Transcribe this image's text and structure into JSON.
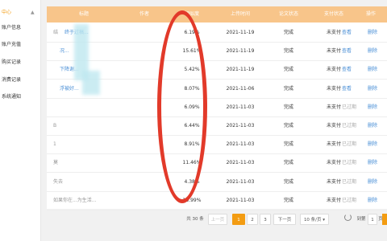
{
  "sidebar": {
    "items": [
      {
        "label": "中心",
        "active": true
      },
      {
        "label": "账户信息"
      },
      {
        "label": "账户充值"
      },
      {
        "label": "购买记录"
      },
      {
        "label": "消费记录"
      },
      {
        "label": "系统通知"
      }
    ],
    "caret": "▲"
  },
  "table": {
    "headers": [
      "标题",
      "作者",
      "相似度",
      "上传时间",
      "论文状态",
      "支付状态",
      "操作"
    ],
    "rows": [
      {
        "title_prefix": "结",
        "title_link": "终于过稿...",
        "similarity": "6.19%",
        "date": "2021-11-19",
        "paper_status": "完成",
        "pay_status": "未支付",
        "action1": "查看",
        "action2": "删除",
        "expired": false
      },
      {
        "title_prefix": "",
        "title_link": "况...",
        "similarity": "15.61%",
        "date": "2021-11-19",
        "paper_status": "完成",
        "pay_status": "未支付",
        "action1": "查看",
        "action2": "删除",
        "expired": false
      },
      {
        "title_prefix": "",
        "title_link": "下降谢...",
        "similarity": "5.42%",
        "date": "2021-11-19",
        "paper_status": "完成",
        "pay_status": "未支付",
        "action1": "查看",
        "action2": "删除",
        "expired": false
      },
      {
        "title_prefix": "",
        "title_link": "浮被好...",
        "similarity": "8.07%",
        "date": "2021-11-06",
        "paper_status": "完成",
        "pay_status": "未支付",
        "action1": "查看",
        "action2": "删除",
        "expired": false
      },
      {
        "title_prefix": "",
        "title_link": "",
        "similarity": "6.09%",
        "date": "2021-11-03",
        "paper_status": "完成",
        "pay_status": "未支付",
        "action1": "已过期",
        "action2": "删除",
        "expired": true
      },
      {
        "title_prefix": "B",
        "title_link": "",
        "similarity": "6.44%",
        "date": "2021-11-03",
        "paper_status": "完成",
        "pay_status": "未支付",
        "action1": "已过期",
        "action2": "删除",
        "expired": true
      },
      {
        "title_prefix": "1",
        "title_link": "",
        "similarity": "8.91%",
        "date": "2021-11-03",
        "paper_status": "完成",
        "pay_status": "未支付",
        "action1": "已过期",
        "action2": "删除",
        "expired": true
      },
      {
        "title_prefix": "莫",
        "title_link": "",
        "similarity": "11.46%",
        "date": "2021-11-03",
        "paper_status": "完成",
        "pay_status": "未支付",
        "action1": "已过期",
        "action2": "删除",
        "expired": true
      },
      {
        "title_prefix": "失去",
        "title_link": "",
        "similarity": "4.38%",
        "date": "2021-11-03",
        "paper_status": "完成",
        "pay_status": "未支付",
        "action1": "已过期",
        "action2": "删除",
        "expired": true
      },
      {
        "title_prefix": "如果你在...为生活...",
        "title_link": "",
        "similarity": "13.99%",
        "date": "2021-11-03",
        "paper_status": "完成",
        "pay_status": "未支付",
        "action1": "已过期",
        "action2": "删除",
        "expired": true
      }
    ]
  },
  "pagination": {
    "total": "共 30 条",
    "prev": "上一页",
    "pages": [
      "1",
      "2",
      "3"
    ],
    "current": "1",
    "next": "下一页",
    "page_size": "10 条/页",
    "goto_label": "到第",
    "goto_value": "1",
    "page_unit": "页"
  },
  "colors": {
    "header_bg": "#f8c58a",
    "accent": "#f39c12",
    "link": "#4a8fd6",
    "highlight_oval": "#e23a2a"
  }
}
